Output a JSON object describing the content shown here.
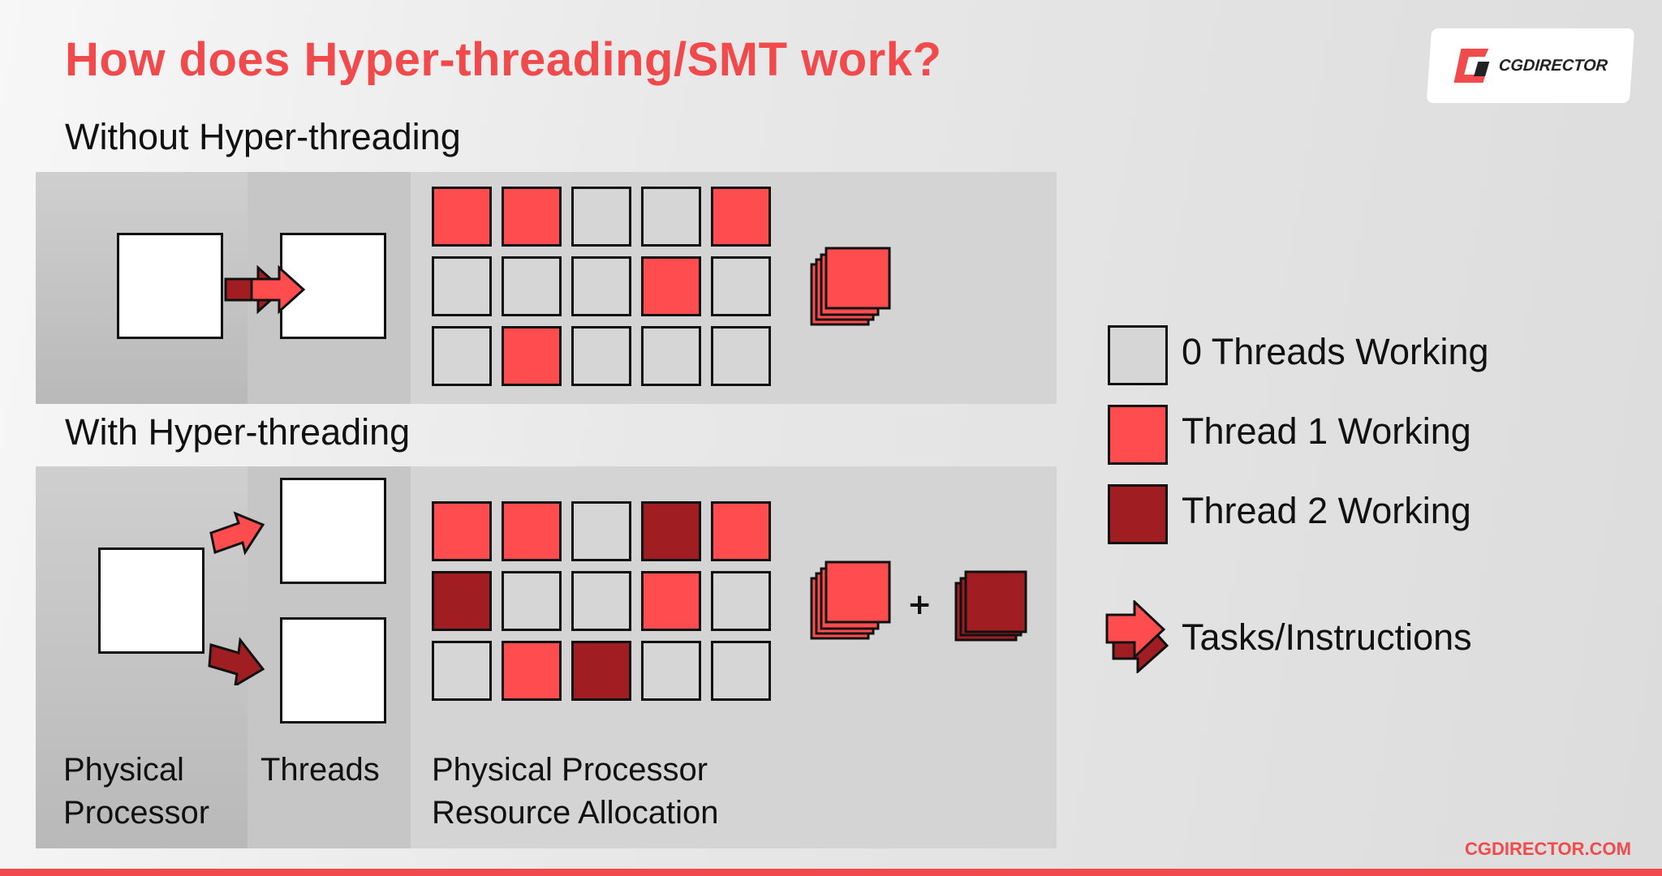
{
  "title": "How does Hyper-threading/SMT work?",
  "logo": {
    "text": "CGDIRECTOR"
  },
  "section_without": "Without Hyper-threading",
  "section_with": "With Hyper-threading",
  "colors": {
    "empty": "#d6d6d6",
    "thread1": "#ff4d4f",
    "thread2": "#a01e22",
    "accent": "#f04a4c"
  },
  "grid_without": [
    [
      1,
      1,
      0,
      0,
      1
    ],
    [
      0,
      0,
      0,
      1,
      0
    ],
    [
      0,
      1,
      0,
      0,
      0
    ]
  ],
  "grid_with": [
    [
      1,
      1,
      0,
      2,
      1
    ],
    [
      2,
      0,
      0,
      1,
      0
    ],
    [
      0,
      1,
      2,
      0,
      0
    ]
  ],
  "plus": "+",
  "column_labels": {
    "physical_processor": "Physical\nProcessor",
    "threads": "Threads",
    "allocation": "Physical Processor\nResource Allocation"
  },
  "legend": [
    {
      "state": 0,
      "label": "0 Threads Working"
    },
    {
      "state": 1,
      "label": "Thread 1 Working"
    },
    {
      "state": 2,
      "label": "Thread 2 Working"
    },
    {
      "icon": "arrow-icon",
      "label": "Tasks/Instructions"
    }
  ],
  "footer": "CGDIRECTOR.COM"
}
